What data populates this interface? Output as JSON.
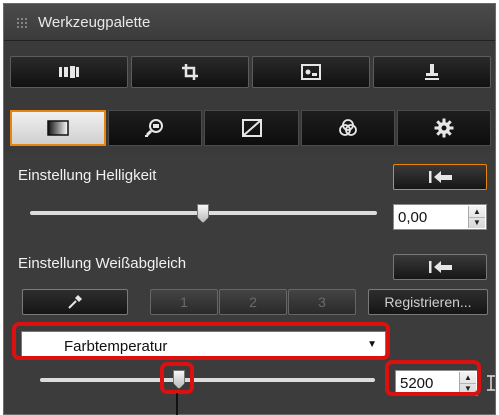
{
  "window": {
    "title": "Werkzeugpalette"
  },
  "toolbar": {
    "buttons": [
      {
        "icon": "film-strip-icon"
      },
      {
        "icon": "crop-icon"
      },
      {
        "icon": "image-view-icon"
      },
      {
        "icon": "stamp-icon"
      }
    ]
  },
  "tabs": [
    {
      "icon": "basic-adjust-icon",
      "active": true
    },
    {
      "icon": "zoom-image-icon",
      "active": false
    },
    {
      "icon": "tone-curve-icon",
      "active": false
    },
    {
      "icon": "color-circles-icon",
      "active": false
    },
    {
      "icon": "settings-gear-icon",
      "active": false
    }
  ],
  "brightness": {
    "label": "Einstellung Helligkeit",
    "value": "0,00",
    "slider_fraction": 0.5
  },
  "white_balance": {
    "label": "Einstellung Weißabgleich",
    "picker_icon": "eyedropper-icon",
    "presets": [
      "1",
      "2",
      "3"
    ],
    "register_label": "Registrieren...",
    "mode_selected": "Farbtemperatur",
    "temperature_value": "5200",
    "temperature_slider_fraction": 0.41
  },
  "colors": {
    "accent": "#e8840c",
    "highlight": "#dd1010",
    "panel_bg": "#3c3c3c"
  }
}
